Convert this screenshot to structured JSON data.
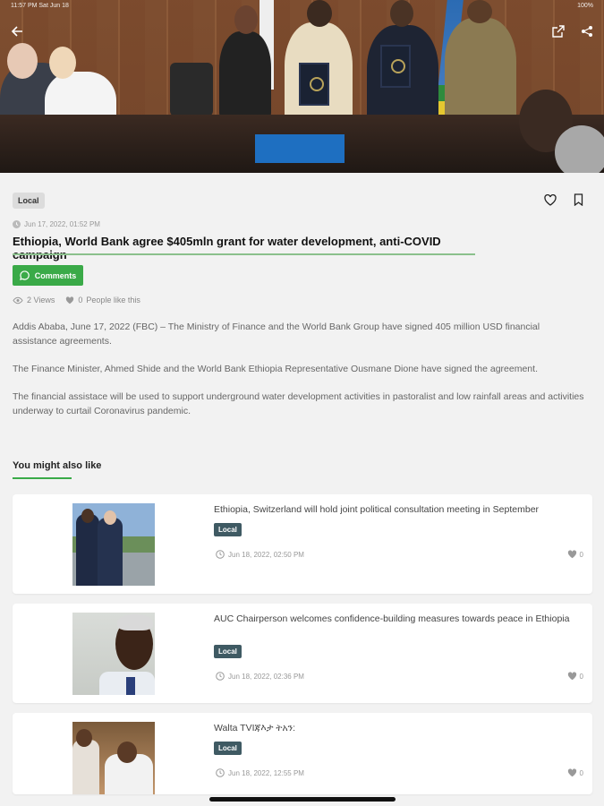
{
  "status_bar": {
    "time_date": "11:57 PM  Sat Jun 18",
    "battery": "100%"
  },
  "article": {
    "category": "Local",
    "date": "Jun 17, 2022, 01:52 PM",
    "title": "Ethiopia, World Bank agree $405mln grant for water development, anti-COVID campaign",
    "comments_label": "Comments",
    "views": "2 Views",
    "likes": "0",
    "likes_label": "People like this",
    "paragraphs": [
      "Addis Ababa, June 17, 2022 (FBC) – The Ministry of Finance and the World Bank Group have signed 405 million USD financial assistance agreements.",
      "The Finance Minister, Ahmed Shide and the World Bank Ethiopia Representative Ousmane Dione have signed the agreement.",
      "The financial assistace will be used to support underground water development activities in pastoralist and low rainfall areas and activities underway to curtail Coronavirus pandemic."
    ]
  },
  "related": {
    "section_title": "You might also like",
    "items": [
      {
        "title": "Ethiopia, Switzerland will hold joint political consultation meeting in September",
        "tag": "Local",
        "date": "Jun 18, 2022, 02:50 PM",
        "likes": "0"
      },
      {
        "title": "AUC Chairperson welcomes confidence-building measures towards peace in Ethiopia",
        "tag": "Local",
        "date": "Jun 18, 2022, 02:36 PM",
        "likes": "0"
      },
      {
        "title": "Walta TVIጃእታ ትአን:",
        "tag": "Local",
        "date": "Jun 18, 2022, 12:55 PM",
        "likes": "0"
      }
    ]
  },
  "colors": {
    "accent": "#3aaa48",
    "tag_dark": "#3f5a63",
    "background": "#f2f2f2"
  }
}
